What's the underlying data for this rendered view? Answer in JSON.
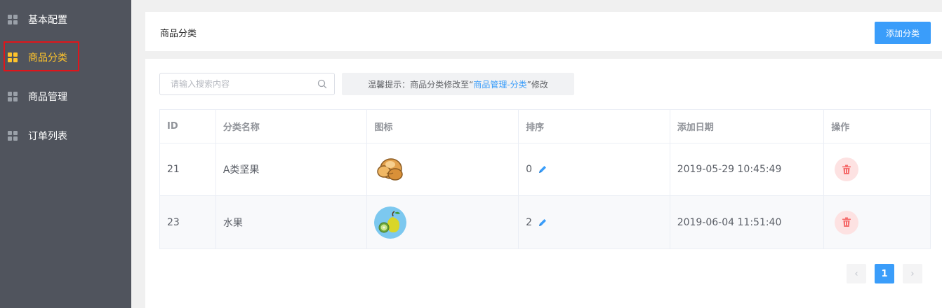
{
  "sidebar": {
    "items": [
      {
        "label": "基本配置",
        "icon": "grid-icon",
        "active": false
      },
      {
        "label": "商品分类",
        "icon": "grid-icon",
        "active": true
      },
      {
        "label": "商品管理",
        "icon": "grid-icon",
        "active": false
      },
      {
        "label": "订单列表",
        "icon": "grid-icon",
        "active": false
      }
    ]
  },
  "header": {
    "title": "商品分类",
    "add_button": "添加分类"
  },
  "toolbar": {
    "search_placeholder": "请输入搜索内容",
    "tip_prefix": "温馨提示：商品分类修改至“",
    "tip_link": "商品管理-分类",
    "tip_suffix": "”修改"
  },
  "table": {
    "headers": [
      "ID",
      "分类名称",
      "图标",
      "排序",
      "添加日期",
      "操作"
    ],
    "rows": [
      {
        "id": "21",
        "name": "A类坚果",
        "icon": "nuts-thumbnail",
        "sort": "0",
        "date": "2019-05-29 10:45:49"
      },
      {
        "id": "23",
        "name": "水果",
        "icon": "fruit-thumbnail",
        "sort": "2",
        "date": "2019-06-04 11:51:40"
      }
    ]
  },
  "pagination": {
    "current_page": "1",
    "prev_icon": "‹",
    "next_icon": "›"
  },
  "colors": {
    "sidebar_bg": "#50545d",
    "active": "#ffc42b",
    "primary": "#3a9dfa",
    "highlight_border": "#e0151b",
    "danger_bg": "#fde2e2",
    "danger": "#f56c6c"
  }
}
